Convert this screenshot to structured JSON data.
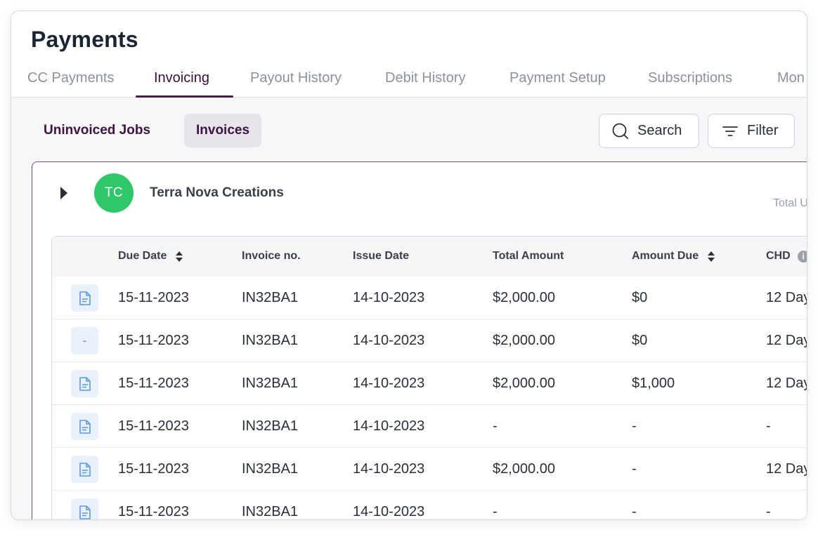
{
  "page": {
    "title": "Payments"
  },
  "tabs": [
    {
      "label": "CC Payments",
      "active": false
    },
    {
      "label": "Invoicing",
      "active": true
    },
    {
      "label": "Payout History",
      "active": false
    },
    {
      "label": "Debit History",
      "active": false
    },
    {
      "label": "Payment Setup",
      "active": false
    },
    {
      "label": "Subscriptions",
      "active": false
    },
    {
      "label": "Mon",
      "active": false
    }
  ],
  "subtabs": [
    {
      "label": "Uninvoiced Jobs",
      "active": false
    },
    {
      "label": "Invoices",
      "active": true
    }
  ],
  "actions": {
    "search_label": "Search",
    "filter_label": "Filter"
  },
  "customer": {
    "initials": "TC",
    "name": "Terra Nova Creations",
    "total_label": "Total U",
    "avatar_color": "#2ec86a"
  },
  "table": {
    "columns": [
      {
        "label": "Due Date",
        "sortable": true
      },
      {
        "label": "Invoice no.",
        "sortable": false
      },
      {
        "label": "Issue Date",
        "sortable": false
      },
      {
        "label": "Total Amount",
        "sortable": false
      },
      {
        "label": "Amount Due",
        "sortable": true
      },
      {
        "label": "CHD",
        "sortable": false,
        "info_icon": "i"
      }
    ],
    "rows": [
      {
        "icon": "document-icon",
        "icon_glyph": "",
        "due_date": "15-11-2023",
        "invoice_no": "IN32BA1",
        "issue_date": "14-10-2023",
        "total_amount": "$2,000.00",
        "amount_due": "$0",
        "chd": "12 Day"
      },
      {
        "icon": "dash-icon",
        "icon_glyph": "-",
        "due_date": "15-11-2023",
        "invoice_no": "IN32BA1",
        "issue_date": "14-10-2023",
        "total_amount": "$2,000.00",
        "amount_due": "$0",
        "chd": "12 Day"
      },
      {
        "icon": "document-icon",
        "icon_glyph": "",
        "due_date": "15-11-2023",
        "invoice_no": "IN32BA1",
        "issue_date": "14-10-2023",
        "total_amount": "$2,000.00",
        "amount_due": "$1,000",
        "chd": "12 Day"
      },
      {
        "icon": "document-icon",
        "icon_glyph": "",
        "due_date": "15-11-2023",
        "invoice_no": "IN32BA1",
        "issue_date": "14-10-2023",
        "total_amount": "-",
        "amount_due": "-",
        "chd": "-"
      },
      {
        "icon": "document-icon",
        "icon_glyph": "",
        "due_date": "15-11-2023",
        "invoice_no": "IN32BA1",
        "issue_date": "14-10-2023",
        "total_amount": "$2,000.00",
        "amount_due": "-",
        "chd": "12 Day"
      },
      {
        "icon": "document-icon",
        "icon_glyph": "",
        "due_date": "15-11-2023",
        "invoice_no": "IN32BA1",
        "issue_date": "14-10-2023",
        "total_amount": "-",
        "amount_due": "-",
        "chd": "-"
      }
    ]
  },
  "colors": {
    "accent": "#4a1b4d",
    "icon_blue": "#5b9be0"
  }
}
